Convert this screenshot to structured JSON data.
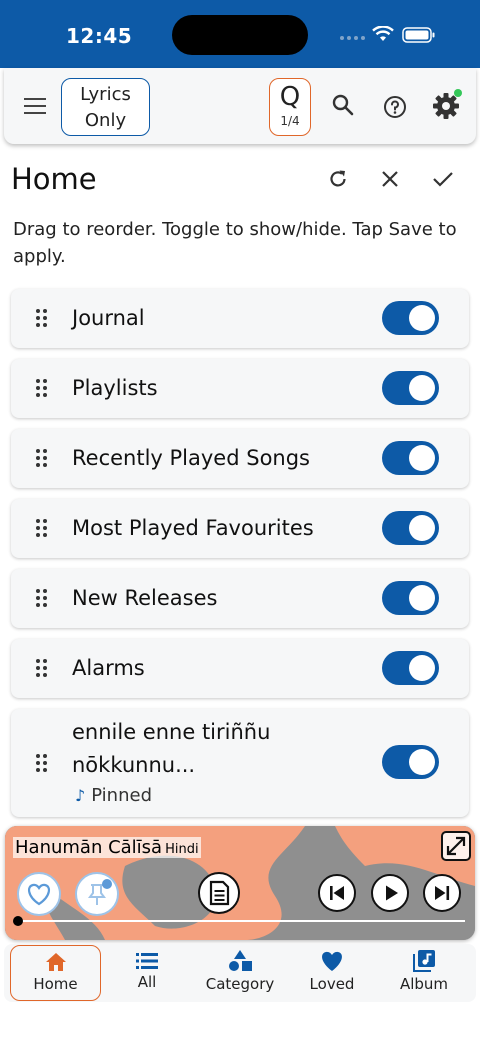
{
  "status_bar": {
    "time": "12:45"
  },
  "toolbar": {
    "lyrics_button": "Lyrics\nOnly",
    "queue_letter": "Q",
    "queue_count": "1/4",
    "icons": [
      "menu-icon",
      "search-icon",
      "help-icon",
      "settings-icon"
    ]
  },
  "header": {
    "title": "Home",
    "actions": [
      "refresh-icon",
      "close-icon",
      "check-icon"
    ]
  },
  "instructions": "Drag to reorder. Toggle to show/hide. Tap Save to apply.",
  "sections": [
    {
      "label": "Journal",
      "enabled": true
    },
    {
      "label": "Playlists",
      "enabled": true
    },
    {
      "label": "Recently Played Songs",
      "enabled": true
    },
    {
      "label": "Most Played Favourites",
      "enabled": true
    },
    {
      "label": "New Releases",
      "enabled": true
    },
    {
      "label": "Alarms",
      "enabled": true
    },
    {
      "label": "ennile enne tiriññu nōkkunnu...",
      "sublabel": "Pinned",
      "enabled": true
    }
  ],
  "player": {
    "title": "Hanumān Cālīsā",
    "language": "Hindi",
    "progress": 0.0
  },
  "bottom_nav": [
    {
      "label": "Home",
      "icon": "home-icon",
      "active": true
    },
    {
      "label": "All",
      "icon": "list-icon",
      "active": false
    },
    {
      "label": "Category",
      "icon": "category-icon",
      "active": false
    },
    {
      "label": "Loved",
      "icon": "heart-icon",
      "active": false
    },
    {
      "label": "Album",
      "icon": "album-icon",
      "active": false
    }
  ],
  "colors": {
    "brand_blue": "#0d5aa7",
    "accent_orange": "#e0672a",
    "status_green": "#34c759",
    "player_art": "#f4a07e"
  }
}
